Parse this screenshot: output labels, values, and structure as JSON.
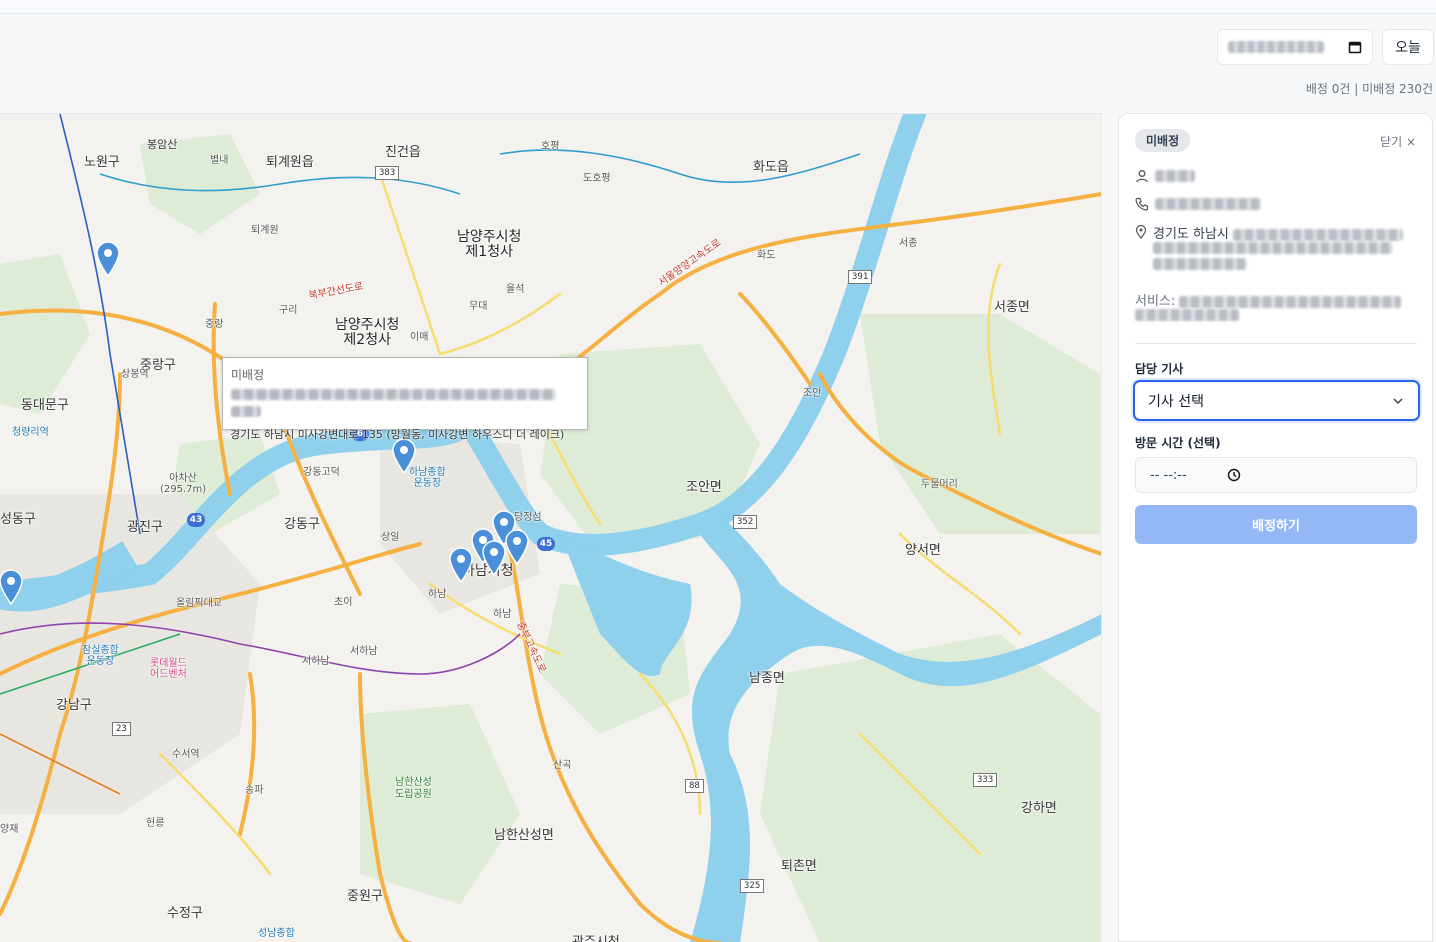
{
  "header": {
    "today_label": "오늘",
    "counts_label": "배정 0건 | 미배정 230건"
  },
  "map": {
    "labels": {
      "bongsan": "봉암산",
      "nowon": "노원구",
      "byeolnae": "별내",
      "toegyewon": "퇴계원읍",
      "toegyewon_ic": "퇴계원",
      "jingeon": "진건읍",
      "hopyeong": "호평",
      "dohopyeong": "도호평",
      "hwado": "화도읍",
      "hwado_ic": "화도",
      "namyangju1": "남양주시청\n제1청사",
      "namyangju2": "남양주시청\n제2청사",
      "mudae": "무대",
      "yulseok": "율석",
      "imae": "이매",
      "jungnang": "중랑",
      "guri": "구리",
      "jungnanggu": "중랑구",
      "sangbong": "상봉역",
      "dongdaemun": "동대문구",
      "cheongnyangni": "청량리역",
      "seongdong": "성동구",
      "gwangjin": "광진구",
      "achasan": "아차산\n(295.7m)",
      "gangdong": "강동구",
      "gangdong_ic": "강동고덕",
      "hanam_stadium": "하남종합\n운동장",
      "dangjeong": "당정섬",
      "hanam_city": "하남시청",
      "hanam": "하남",
      "hanam2": "하남",
      "sangil": "상일",
      "choi": "초이",
      "olympic": "올림픽대교",
      "jamsil": "잠실종합\n운동장",
      "lotte": "롯데월드\n어드벤처",
      "seohanam": "서하남",
      "seohanam_ic": "서하남",
      "gangnam": "강남구",
      "suseo": "수서역",
      "songpa": "송파",
      "hyeonleung": "헌릉",
      "yangjae": "양재",
      "sujeong": "수정구",
      "jungwon": "중원구",
      "seongnam": "성남종합",
      "namhansanseong": "남한산성\n도립공원",
      "namhansanseongmyeon": "남한산성면",
      "sangok": "산곡",
      "gwangju": "광주시청",
      "joan": "조안면",
      "joan_ic": "조안",
      "seojong": "서종",
      "seojongmyeon": "서종면",
      "dumulmeori": "두물머리",
      "yangseo": "양서면",
      "namjong": "남종면",
      "toechon": "퇴촌면",
      "gangha": "강하면",
      "hwado_highway": "서울양양고속도로",
      "bukbu": "북부간선도로",
      "jungbu": "중부고속도로"
    },
    "routes": [
      "383",
      "391",
      "352",
      "88",
      "325",
      "333",
      "23"
    ],
    "circle_routes": [
      "43",
      "45",
      "6"
    ],
    "tooltip": {
      "status": "미배정",
      "address": "경기도 하남시 미사강변대로 135 (망월동, 미사강변 하우스디 더 레이크)"
    }
  },
  "panel": {
    "status_badge": "미배정",
    "close_label": "닫기 ×",
    "address_prefix": "경기도 하남시",
    "service_label": "서비스:",
    "driver_label": "담당 기사",
    "driver_select": "기사 선택",
    "visit_time_label": "방문 시간 (선택)",
    "time_placeholder": "-- --:--",
    "assign_button": "배정하기"
  },
  "colors": {
    "accent": "#2563eb",
    "assign_disabled": "#93b8f5",
    "water": "#8fd0ec",
    "highway": "#f5b041",
    "pin": "#4a90d9"
  }
}
